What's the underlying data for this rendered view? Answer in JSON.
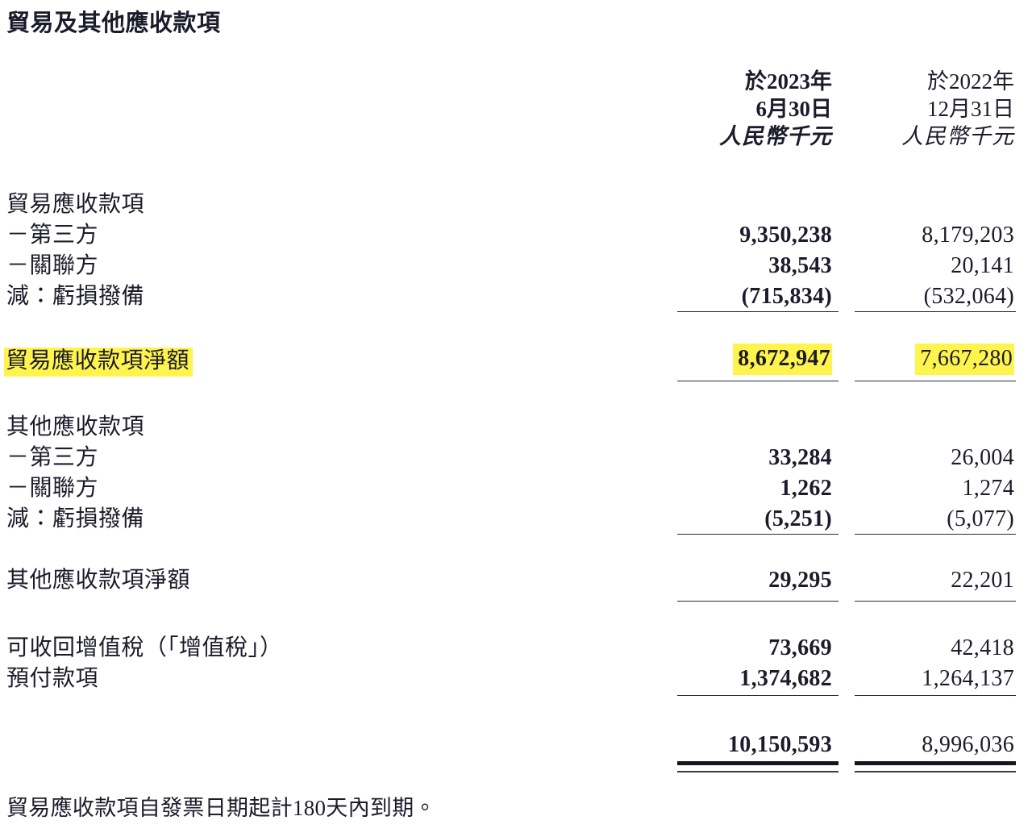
{
  "title": "貿易及其他應收款項",
  "columns": [
    {
      "line1": "於2023年",
      "line2": "6月30日",
      "unit": "人民幣千元"
    },
    {
      "line1": "於2022年",
      "line2": "12月31日",
      "unit": "人民幣千元"
    }
  ],
  "rows": {
    "trade_receivables_header": "貿易應收款項",
    "third_party": "－第三方",
    "related_party": "－關聯方",
    "less_loss_allowance": "減：虧損撥備",
    "trade_receivables_net": "貿易應收款項淨額",
    "other_receivables_header": "其他應收款項",
    "other_third_party": "－第三方",
    "other_related_party": "－關聯方",
    "other_less_loss_allowance": "減：虧損撥備",
    "other_receivables_net": "其他應收款項淨額",
    "vat_recoverable": "可收回增值稅（「增值稅」）",
    "prepayments": "預付款項"
  },
  "values": {
    "trade_third_party": {
      "c1": "9,350,238",
      "c2": "8,179,203"
    },
    "trade_related_party": {
      "c1": "38,543",
      "c2": "20,141"
    },
    "trade_loss_allowance": {
      "c1": "(715,834)",
      "c2": "(532,064)"
    },
    "trade_net": {
      "c1": "8,672,947",
      "c2": "7,667,280"
    },
    "other_third_party": {
      "c1": "33,284",
      "c2": "26,004"
    },
    "other_related_party": {
      "c1": "1,262",
      "c2": "1,274"
    },
    "other_loss_allowance": {
      "c1": "(5,251)",
      "c2": "(5,077)"
    },
    "other_net": {
      "c1": "29,295",
      "c2": "22,201"
    },
    "vat_recoverable": {
      "c1": "73,669",
      "c2": "42,418"
    },
    "prepayments": {
      "c1": "1,374,682",
      "c2": "1,264,137"
    },
    "total": {
      "c1": "10,150,593",
      "c2": "8,996,036"
    }
  },
  "footnote": "貿易應收款項自發票日期起計180天內到期。",
  "highlight_color": "#fff44d",
  "text_color": "#1b1b2b"
}
